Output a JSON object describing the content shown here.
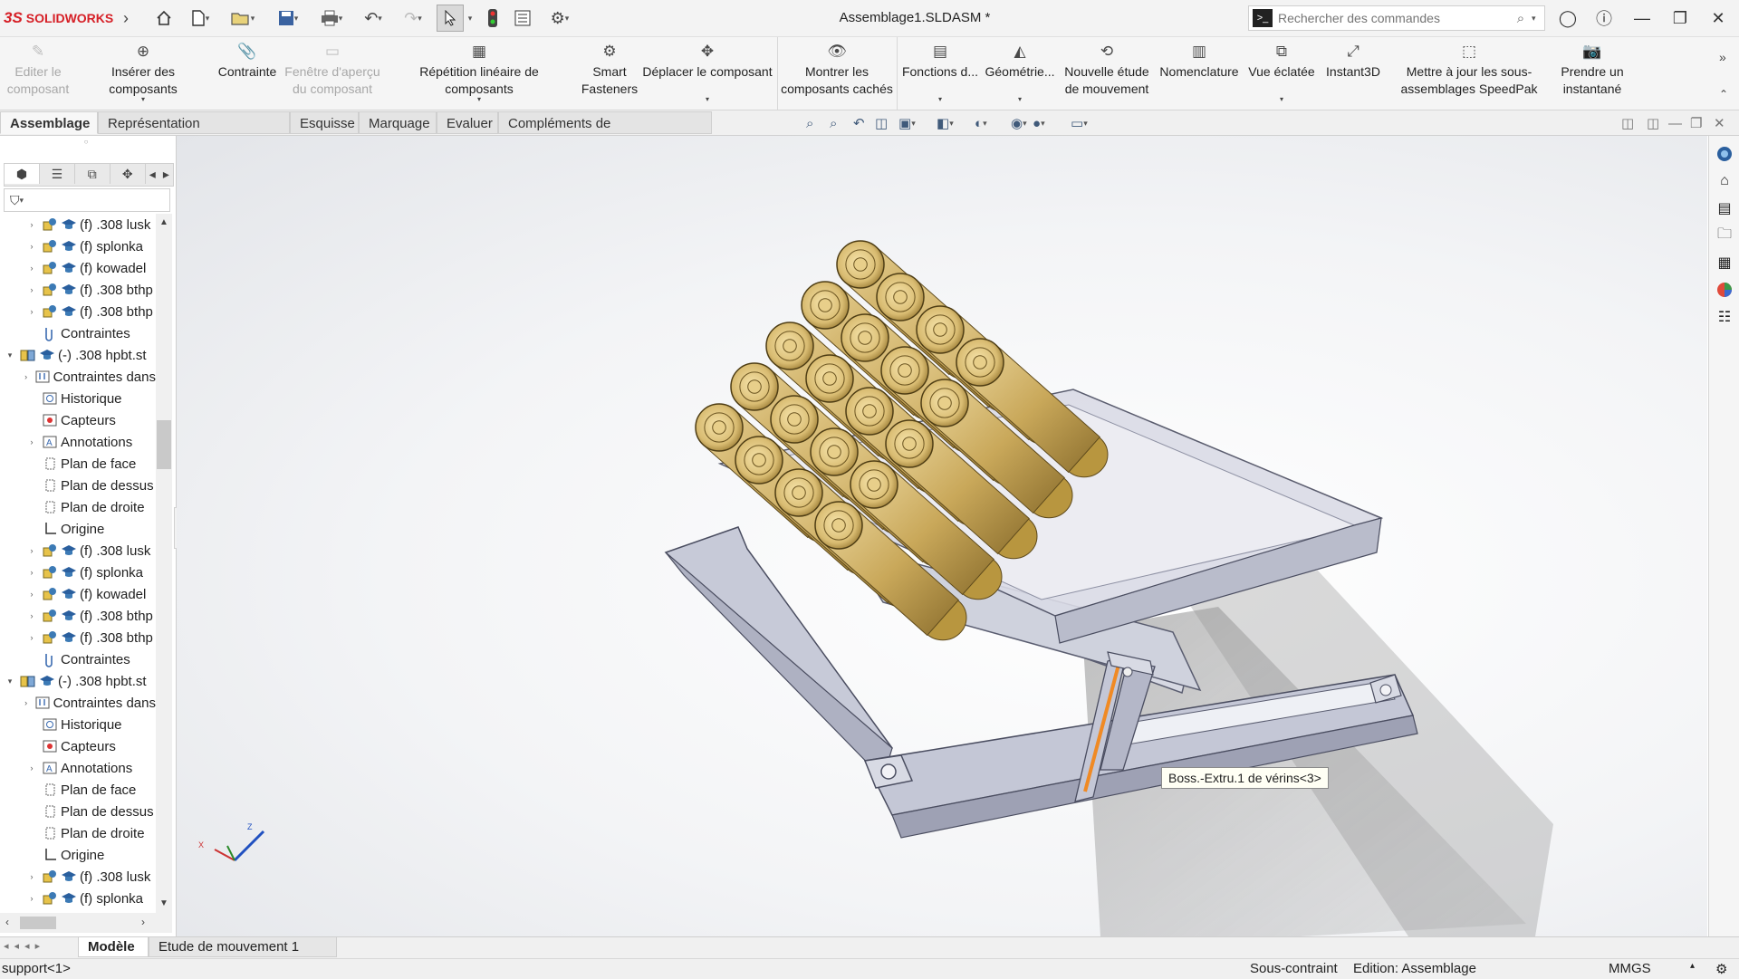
{
  "app": {
    "brand_prefix": "3S",
    "brand": "SOLIDWORKS",
    "doc_title": "Assemblage1.SLDASM *"
  },
  "search": {
    "placeholder": "Rechercher des commandes"
  },
  "commands": [
    {
      "label": "Editer le composant",
      "enabled": false,
      "icon": "edit-component-icon"
    },
    {
      "label": "Insérer des composants",
      "enabled": true,
      "icon": "insert-components-icon"
    },
    {
      "label": "Contrainte",
      "enabled": true,
      "icon": "mate-paperclip-icon"
    },
    {
      "label": "Fenêtre d'aperçu du composant",
      "enabled": false,
      "icon": "preview-window-icon"
    },
    {
      "label": "Répétition linéaire de composants",
      "enabled": true,
      "icon": "linear-pattern-icon"
    },
    {
      "label": "Smart Fasteners",
      "enabled": true,
      "icon": "smart-fasteners-icon"
    },
    {
      "label": "Déplacer le composant",
      "enabled": true,
      "icon": "move-component-icon"
    },
    {
      "label": "Montrer les composants cachés",
      "enabled": true,
      "icon": "show-hidden-icon"
    },
    {
      "label": "Fonctions d...",
      "enabled": true,
      "icon": "assembly-features-icon"
    },
    {
      "label": "Géométrie...",
      "enabled": true,
      "icon": "reference-geometry-icon"
    },
    {
      "label": "Nouvelle étude de mouvement",
      "enabled": true,
      "icon": "motion-study-icon"
    },
    {
      "label": "Nomenclature",
      "enabled": true,
      "icon": "bom-icon"
    },
    {
      "label": "Vue éclatée",
      "enabled": true,
      "icon": "exploded-view-icon"
    },
    {
      "label": "Instant3D",
      "enabled": true,
      "icon": "instant3d-icon"
    },
    {
      "label": "Mettre à jour les sous-assemblages SpeedPak",
      "enabled": true,
      "icon": "speedpak-icon"
    },
    {
      "label": "Prendre un instantané",
      "enabled": true,
      "icon": "camera-icon"
    }
  ],
  "tabs": [
    "Assemblage",
    "Représentation schématique",
    "Esquisse",
    "Marquage",
    "Evaluer",
    "Compléments de SOLIDWORKS"
  ],
  "active_tab": "Assemblage",
  "tree": [
    {
      "depth": 1,
      "label": "(f) .308 lusk",
      "icon": "part-icon",
      "expander": true
    },
    {
      "depth": 1,
      "label": "(f) splonka",
      "icon": "part-icon",
      "expander": true
    },
    {
      "depth": 1,
      "label": "(f) kowadel",
      "icon": "part-icon",
      "expander": true
    },
    {
      "depth": 1,
      "label": "(f) .308 bthp",
      "icon": "part-icon",
      "expander": true
    },
    {
      "depth": 1,
      "label": "(f) .308 bthp",
      "icon": "part-icon",
      "expander": true
    },
    {
      "depth": 1,
      "label": "Contraintes",
      "icon": "mates-icon",
      "expander": false
    },
    {
      "depth": 0,
      "label": "(-) .308 hpbt.st",
      "icon": "subassembly-icon",
      "expander": "open"
    },
    {
      "depth": 1,
      "label": "Contraintes dans",
      "icon": "mates-folder-icon",
      "expander": true
    },
    {
      "depth": 1,
      "label": "Historique",
      "icon": "history-icon",
      "expander": false
    },
    {
      "depth": 1,
      "label": "Capteurs",
      "icon": "sensors-icon",
      "expander": false
    },
    {
      "depth": 1,
      "label": "Annotations",
      "icon": "annotations-icon",
      "expander": true
    },
    {
      "depth": 1,
      "label": "Plan de face",
      "icon": "plane-icon",
      "expander": false
    },
    {
      "depth": 1,
      "label": "Plan de dessus",
      "icon": "plane-icon",
      "expander": false
    },
    {
      "depth": 1,
      "label": "Plan de droite",
      "icon": "plane-icon",
      "expander": false
    },
    {
      "depth": 1,
      "label": "Origine",
      "icon": "origin-icon",
      "expander": false
    },
    {
      "depth": 1,
      "label": "(f) .308 lusk",
      "icon": "part-icon",
      "expander": true
    },
    {
      "depth": 1,
      "label": "(f) splonka",
      "icon": "part-icon",
      "expander": true
    },
    {
      "depth": 1,
      "label": "(f) kowadel",
      "icon": "part-icon",
      "expander": true
    },
    {
      "depth": 1,
      "label": "(f) .308 bthp",
      "icon": "part-icon",
      "expander": true
    },
    {
      "depth": 1,
      "label": "(f) .308 bthp",
      "icon": "part-icon",
      "expander": true
    },
    {
      "depth": 1,
      "label": "Contraintes",
      "icon": "mates-icon",
      "expander": false
    },
    {
      "depth": 0,
      "label": "(-) .308 hpbt.st",
      "icon": "subassembly-icon",
      "expander": "open"
    },
    {
      "depth": 1,
      "label": "Contraintes dans",
      "icon": "mates-folder-icon",
      "expander": true
    },
    {
      "depth": 1,
      "label": "Historique",
      "icon": "history-icon",
      "expander": false
    },
    {
      "depth": 1,
      "label": "Capteurs",
      "icon": "sensors-icon",
      "expander": false
    },
    {
      "depth": 1,
      "label": "Annotations",
      "icon": "annotations-icon",
      "expander": true
    },
    {
      "depth": 1,
      "label": "Plan de face",
      "icon": "plane-icon",
      "expander": false
    },
    {
      "depth": 1,
      "label": "Plan de dessus",
      "icon": "plane-icon",
      "expander": false
    },
    {
      "depth": 1,
      "label": "Plan de droite",
      "icon": "plane-icon",
      "expander": false
    },
    {
      "depth": 1,
      "label": "Origine",
      "icon": "origin-icon",
      "expander": false
    },
    {
      "depth": 1,
      "label": "(f) .308 lusk",
      "icon": "part-icon",
      "expander": true
    },
    {
      "depth": 1,
      "label": "(f) splonka",
      "icon": "part-icon",
      "expander": true
    }
  ],
  "viewport": {
    "tooltip": "Boss.-Extru.1 de vérins<3>",
    "triad": {
      "x": "X",
      "z": "Z"
    }
  },
  "bottom_tabs": [
    "Modèle",
    "Etude de mouvement 1"
  ],
  "active_bottom_tab": "Modèle",
  "status": {
    "left": "support<1>",
    "constraint": "Sous-contraint",
    "mode": "Edition: Assemblage",
    "units": "MMGS"
  },
  "colors": {
    "brand_red": "#d61f26",
    "brass": "#c9a85a",
    "rack_gray": "#c4c7d6",
    "highlight_orange": "#f08a24"
  }
}
